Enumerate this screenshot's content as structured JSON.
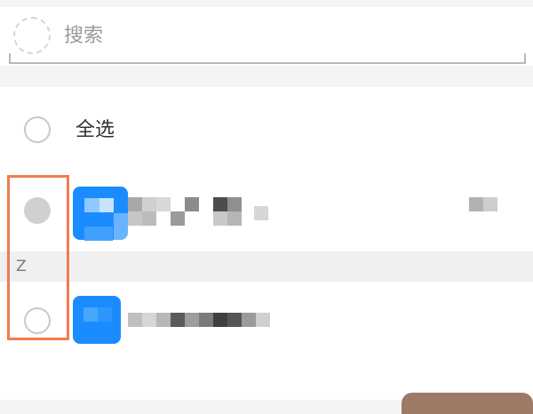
{
  "search": {
    "placeholder": "搜索",
    "icon": "search-icon"
  },
  "list": {
    "select_all_label": "全选",
    "section_index": "Z",
    "contacts": [
      {
        "selected": true,
        "avatar_color": "#1a8cff"
      },
      {
        "selected": false,
        "avatar_color": "#1a8cff"
      }
    ]
  },
  "colors": {
    "highlight": "#f07d4d",
    "accent": "#1a8cff",
    "bottom_button": "#9d7a66"
  }
}
